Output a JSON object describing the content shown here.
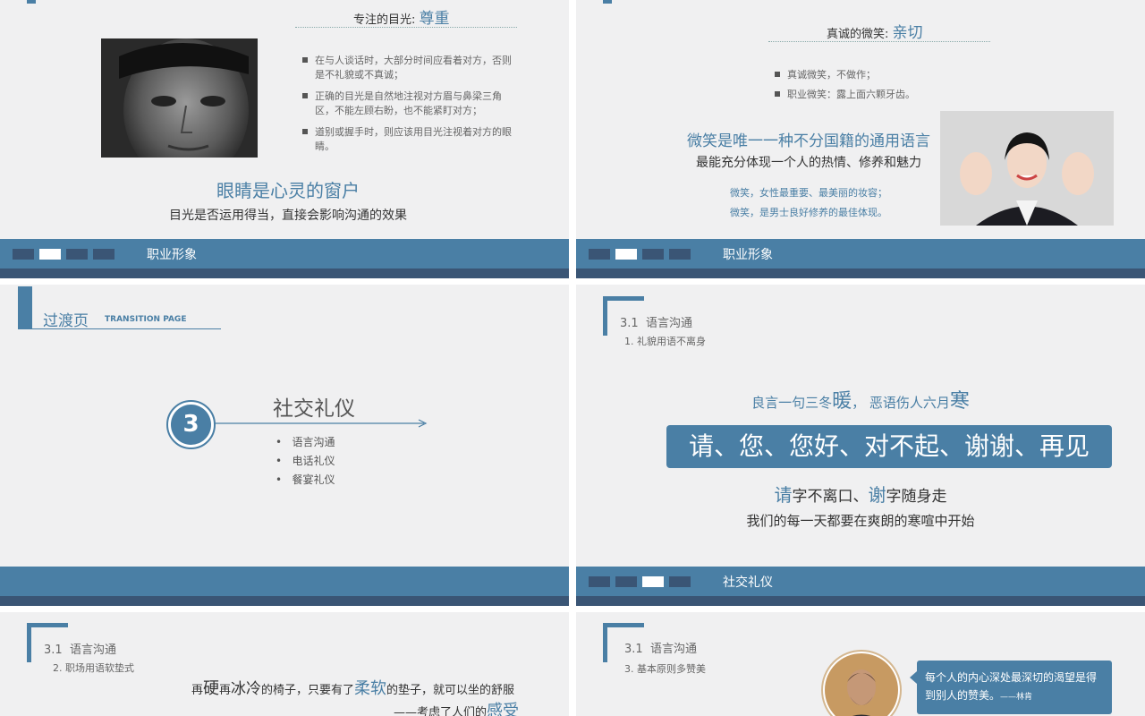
{
  "slide1": {
    "header_prefix": "专注的目光:",
    "header_key": "尊重",
    "bullets": [
      "在与人谈话时，大部分时间应看着对方，否则是不礼貌或不真诚；",
      "正确的目光是自然地注视对方眉与鼻梁三角区，不能左顾右盼，也不能紧盯对方；",
      "道别或握手时，则应该用目光注视着对方的眼睛。"
    ],
    "headline": "眼睛是心灵的窗户",
    "subline": "目光是否运用得当，直接会影响沟通的效果",
    "footer_label": "职业形象"
  },
  "slide2": {
    "header_prefix": "真诚的微笑:",
    "header_key": "亲切",
    "bullets": [
      "真诚微笑，不做作；",
      "职业微笑：露上面六颗牙齿。"
    ],
    "headline": "微笑是唯一一种不分国籍的通用语言",
    "subline": "最能充分体现一个人的热情、修养和魅力",
    "notes": [
      "微笑，女性最重要、最美丽的妆容；",
      "微笑，是男士良好修养的最佳体现。"
    ],
    "footer_label": "职业形象"
  },
  "slide3": {
    "title": "过渡页",
    "title_en": "TRANSITION PAGE",
    "number": "3",
    "section": "社交礼仪",
    "items": [
      "语言沟通",
      "电话礼仪",
      "餐宴礼仪"
    ]
  },
  "slide4": {
    "section_num": "3.1",
    "section": "语言沟通",
    "sub": "1. 礼貌用语不离身",
    "proverb_a": "良言一句三冬",
    "proverb_a_key": "暖",
    "proverb_sep": "，",
    "proverb_b": "恶语伤人六月",
    "proverb_b_key": "寒",
    "banner": "请、您、您好、对不起、谢谢、再见",
    "line1_key1": "请",
    "line1_mid": "字不离口、",
    "line1_key2": "谢",
    "line1_end": "字随身走",
    "line2": "我们的每一天都要在爽朗的寒喧中开始",
    "footer_label": "社交礼仪"
  },
  "slide5": {
    "section_num": "3.1",
    "section": "语言沟通",
    "sub": "2. 职场用语软垫式",
    "q_p1": "再",
    "q_k1": "硬",
    "q_p2": "再",
    "q_k2": "冰冷",
    "q_p3": "的椅子，只要有了",
    "q_k3": "柔软",
    "q_p4": "的垫子，就可以坐的舒服",
    "q2_p1": "——考虑了人们的",
    "q2_k1": "感受"
  },
  "slide6": {
    "section_num": "3.1",
    "section": "语言沟通",
    "sub": "3. 基本原则多赞美",
    "quote": "每个人的内心深处最深切的渴望是得到别人的赞美。",
    "author": "——林肯"
  },
  "colors": {
    "accent": "#4a7fa5",
    "dark_band": "#3a5575",
    "bg": "#f0f0f1"
  }
}
